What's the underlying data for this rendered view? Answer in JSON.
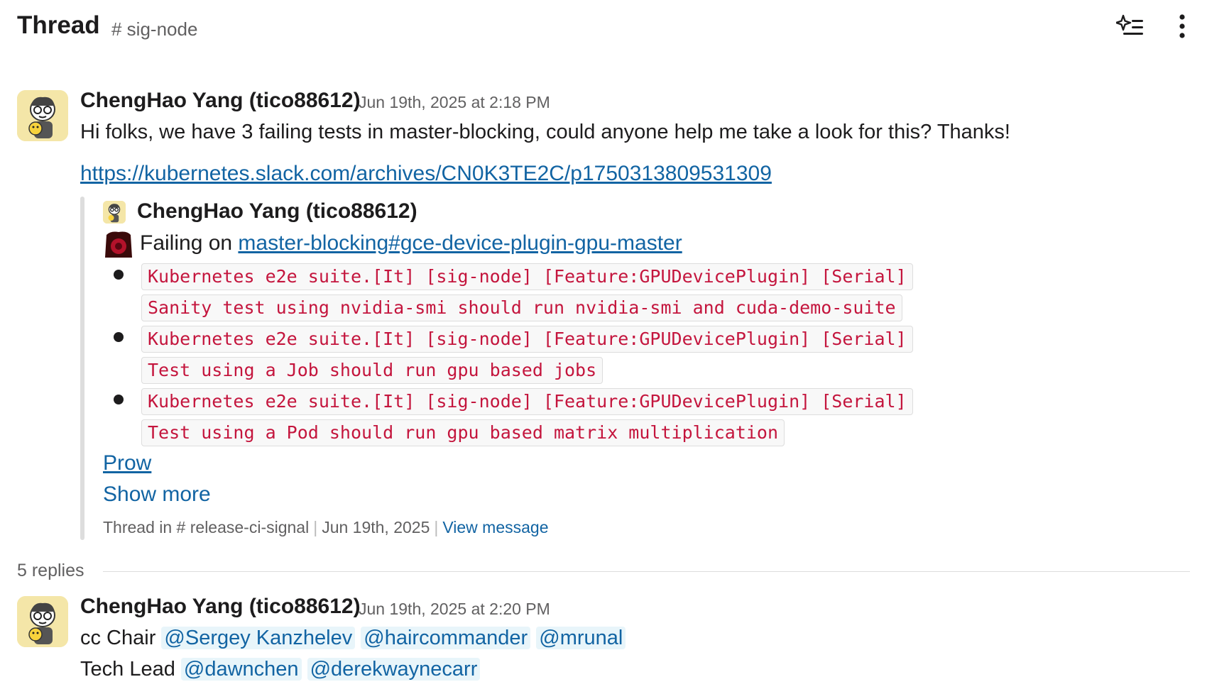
{
  "header": {
    "title": "Thread",
    "channel": "# sig-node",
    "ai_icon": "sparkle-list-icon",
    "more_icon": "vertical-ellipsis-icon"
  },
  "parent_message": {
    "author": "ChengHao Yang (tico88612)",
    "timestamp": "Jun 19th, 2025 at 2:18 PM",
    "text": "Hi folks, we have 3 failing tests in master-blocking, could anyone help me take a look for this? Thanks!",
    "permalink": "https://kubernetes.slack.com/archives/CN0K3TE2C/p1750313809531309",
    "quoted": {
      "author": "ChengHao Yang (tico88612)",
      "failing_prefix": "Failing on",
      "failing_link": "master-blocking#gce-device-plugin-gpu-master",
      "tests": [
        {
          "line1": "Kubernetes e2e suite.[It] [sig-node] [Feature:GPUDevicePlugin] [Serial]",
          "line2": "Sanity test using nvidia-smi should run nvidia-smi and cuda-demo-suite"
        },
        {
          "line1": "Kubernetes e2e suite.[It] [sig-node] [Feature:GPUDevicePlugin] [Serial]",
          "line2": "Test using a Job should run gpu based jobs"
        },
        {
          "line1": "Kubernetes e2e suite.[It] [sig-node] [Feature:GPUDevicePlugin] [Serial]",
          "line2": "Test using a Pod should run gpu based matrix multiplication"
        }
      ],
      "prow_link": "Prow",
      "show_more": "Show more",
      "meta_thread": "Thread in # release-ci-signal",
      "meta_date": "Jun 19th, 2025",
      "meta_view": "View message"
    }
  },
  "replies_label": "5 replies",
  "reply": {
    "author": "ChengHao Yang (tico88612)",
    "timestamp": "Jun 19th, 2025 at 2:20 PM",
    "line1_prefix": "cc Chair",
    "line1_mentions": [
      "@Sergey Kanzhelev",
      "@haircommander",
      "@mrunal"
    ],
    "line2_prefix": "Tech Lead",
    "line2_mentions": [
      "@dawnchen",
      "@derekwaynecarr"
    ]
  },
  "colors": {
    "link": "#1264a3",
    "code_text": "#c4153d",
    "mention_bg": "#e8f5fa",
    "muted": "#616061"
  }
}
